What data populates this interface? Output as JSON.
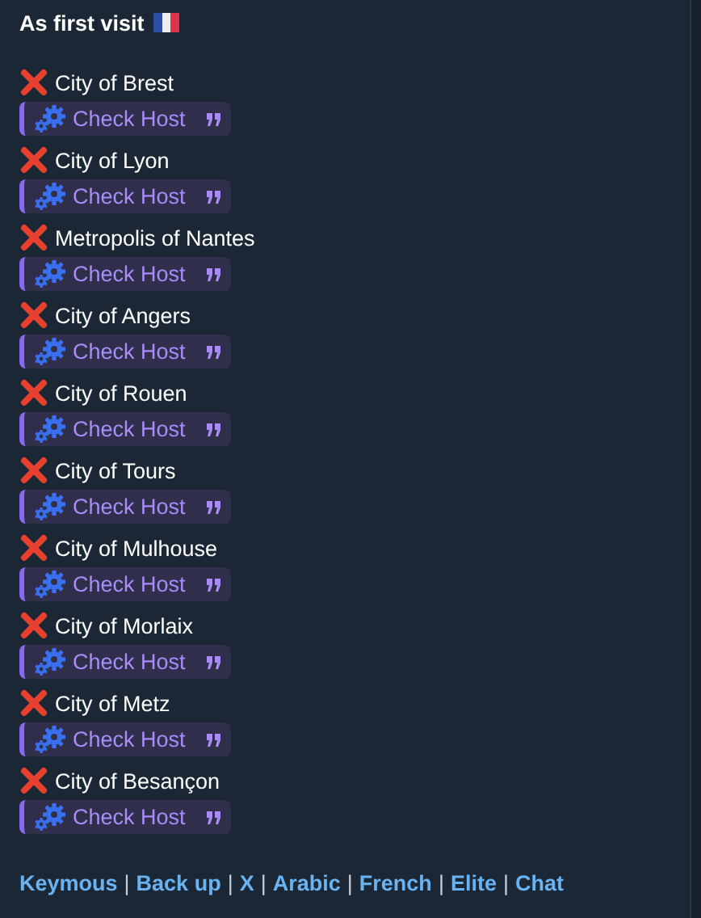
{
  "message": {
    "title": "As first visit",
    "entries": [
      {
        "city": "City of Brest",
        "failed": true,
        "quote": "Check Host"
      },
      {
        "city": "City of Lyon",
        "failed": true,
        "quote": "Check Host"
      },
      {
        "city": "Metropolis of Nantes",
        "failed": true,
        "quote": "Check Host"
      },
      {
        "city": "City of Angers",
        "failed": true,
        "quote": "Check Host"
      },
      {
        "city": "City of Rouen",
        "failed": true,
        "quote": "Check Host"
      },
      {
        "city": "City of Tours",
        "failed": true,
        "quote": "Check Host"
      },
      {
        "city": "City of Mulhouse",
        "failed": true,
        "quote": "Check Host"
      },
      {
        "city": "City of Morlaix",
        "failed": true,
        "quote": "Check Host"
      },
      {
        "city": "City of Metz",
        "failed": true,
        "quote": "Check Host"
      },
      {
        "city": "City of Besançon",
        "failed": true,
        "quote": "Check Host"
      }
    ],
    "links": [
      {
        "label": "Keymous",
        "separator": "|"
      },
      {
        "label": "Back up",
        "separator": "|"
      },
      {
        "label": "X",
        "separator": "|"
      },
      {
        "label": "Arabic",
        "separator": "|"
      },
      {
        "label": "French",
        "separator": "|"
      },
      {
        "label": "Elite",
        "separator": "|"
      },
      {
        "label": "Chat"
      }
    ]
  }
}
